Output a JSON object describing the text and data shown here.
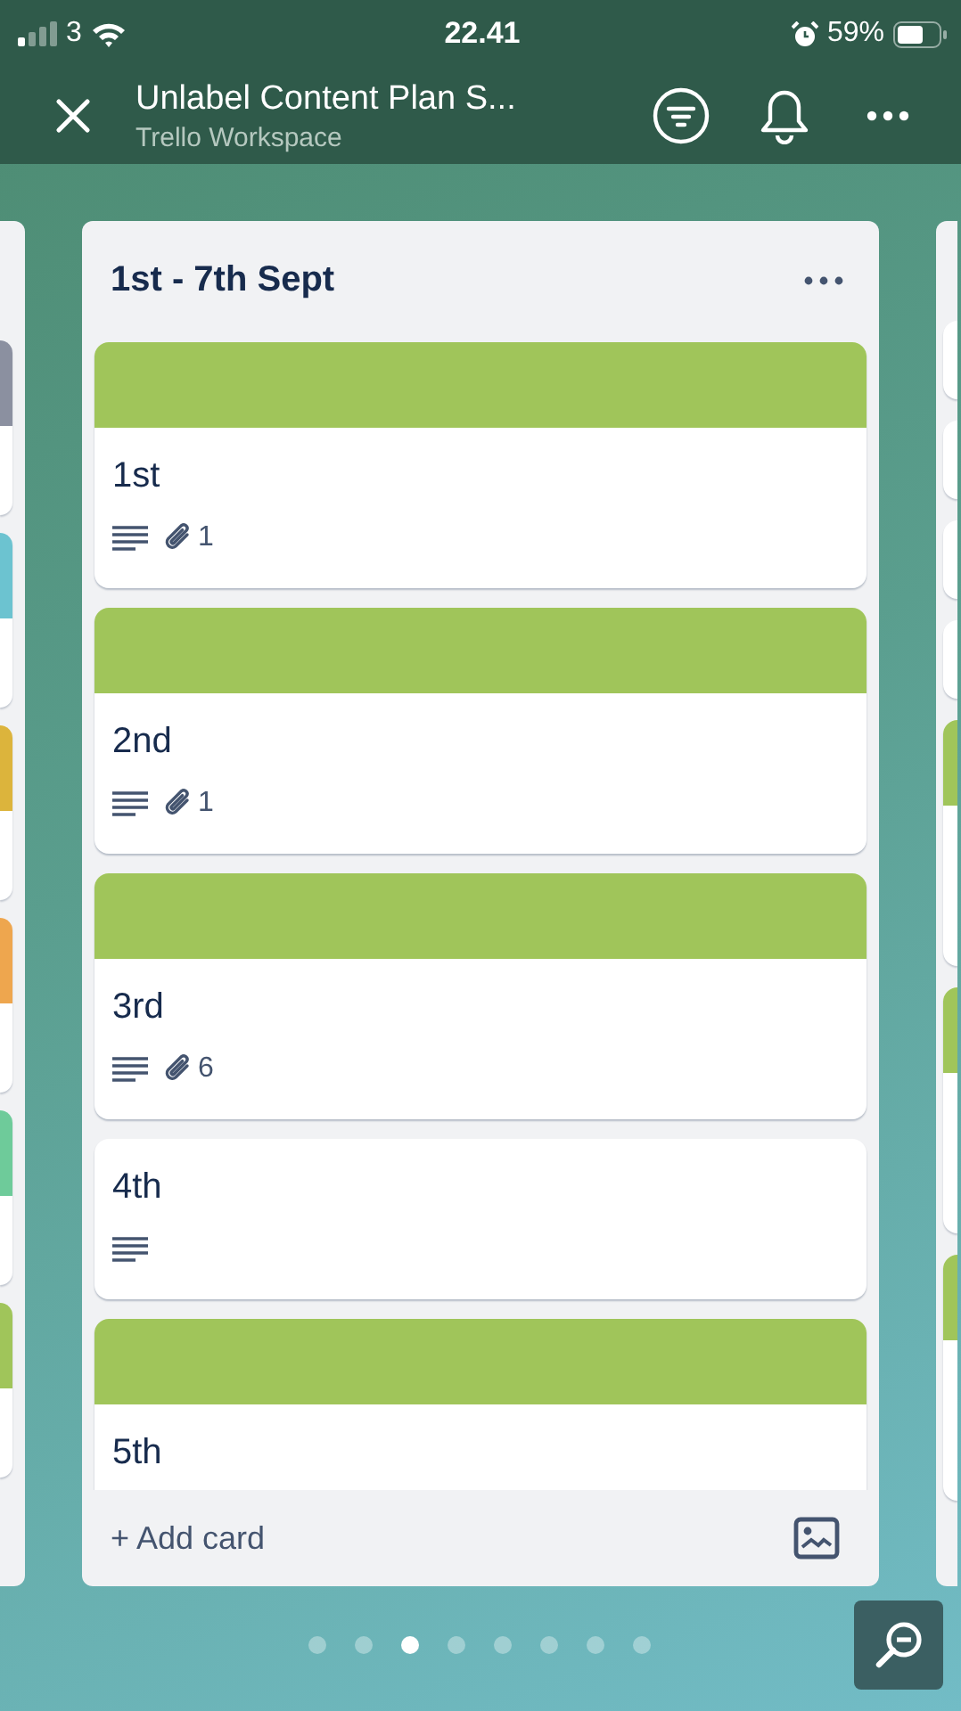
{
  "status_bar": {
    "carrier": "3",
    "time": "22.41",
    "battery": "59%"
  },
  "header": {
    "title": "Unlabel Content Plan S...",
    "subtitle": "Trello Workspace"
  },
  "left_list": {
    "cards": [
      {
        "color": "#8b90a0"
      },
      {
        "color": "#6cc3d0"
      },
      {
        "color": "#dcb43c"
      },
      {
        "color": "#eea64e"
      },
      {
        "color": "#6ecb9a"
      },
      {
        "color": "#a0c55a"
      }
    ]
  },
  "list": {
    "title": "1st - 7th Sept",
    "cards": [
      {
        "title": "1st",
        "color": "#a0c55a",
        "description": true,
        "attachments": "1"
      },
      {
        "title": "2nd",
        "color": "#a0c55a",
        "description": true,
        "attachments": "1"
      },
      {
        "title": "3rd",
        "color": "#a0c55a",
        "description": true,
        "attachments": "6"
      },
      {
        "title": "4th",
        "description": true
      },
      {
        "title": "5th",
        "color": "#a0c55a"
      }
    ],
    "add_card": "+ Add card"
  },
  "right_list": {
    "cards": [
      {
        "kind": "plain"
      },
      {
        "kind": "plain"
      },
      {
        "kind": "plain"
      },
      {
        "kind": "plain"
      },
      {
        "kind": "cover",
        "color": "#a0c55a"
      },
      {
        "kind": "cover",
        "color": "#a0c55a"
      },
      {
        "kind": "cover",
        "color": "#a0c55a"
      }
    ]
  },
  "pages": [
    {
      "selected": false
    },
    {
      "selected": false
    },
    {
      "selected": true
    },
    {
      "selected": false
    },
    {
      "selected": false
    },
    {
      "selected": false
    },
    {
      "selected": false
    },
    {
      "selected": false
    }
  ]
}
